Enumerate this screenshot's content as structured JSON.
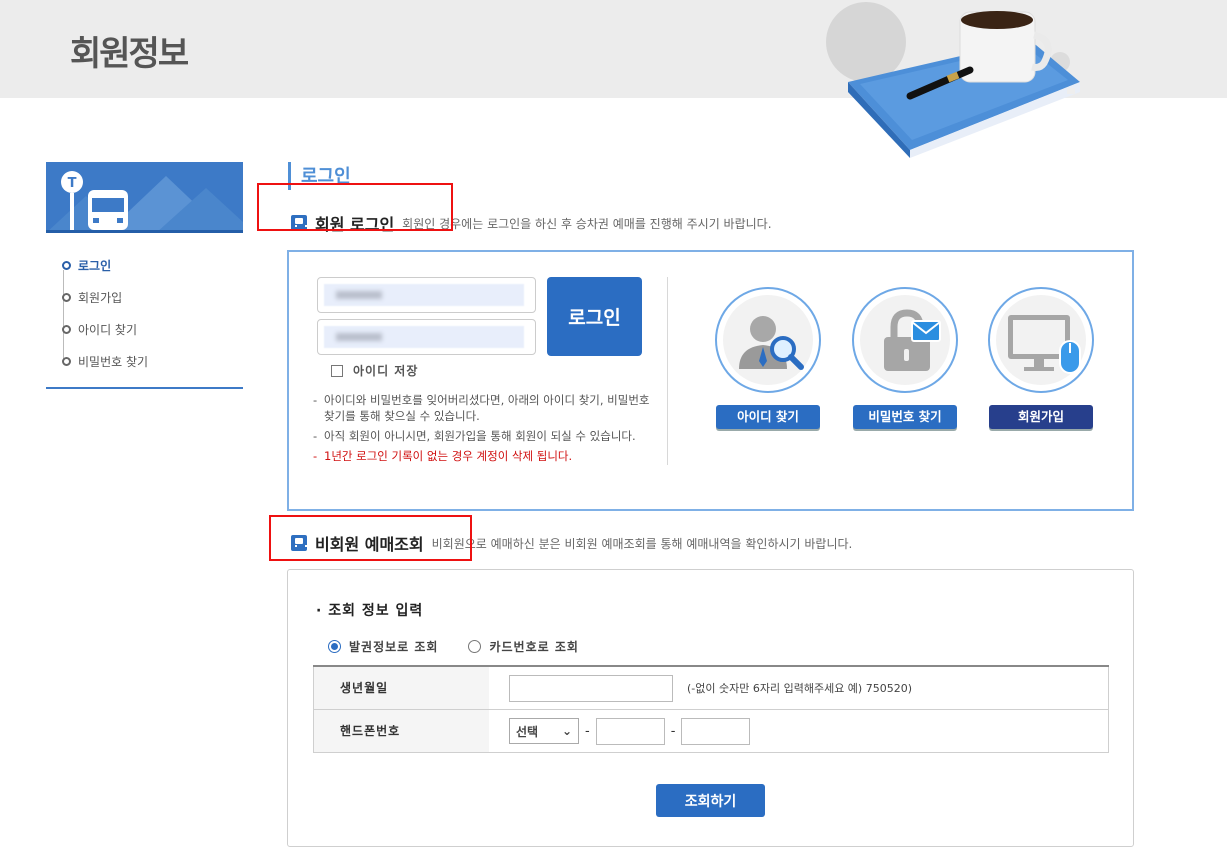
{
  "header": {
    "title": "회원정보"
  },
  "sidebar": {
    "items": [
      {
        "label": "로그인",
        "active": true
      },
      {
        "label": "회원가입",
        "active": false
      },
      {
        "label": "아이디 찾기",
        "active": false
      },
      {
        "label": "비밀번호 찾기",
        "active": false
      }
    ]
  },
  "login_section": {
    "heading": "로그인",
    "member_title": "회원 로그인",
    "member_desc": "회원인 경우에는 로그인을 하신 후 승차권 예매를 진행해 주시기 바랍니다.",
    "login_button": "로그인",
    "save_id_label": "아이디 저장",
    "notes": [
      "아이디와 비밀번호를 잊어버리셨다면, 아래의 아이디 찾기, 비밀번호 찾기를 통해 찾으실 수 있습니다.",
      "아직 회원이 아니시면, 회원가입을 통해 회원이 되실 수 있습니다.",
      "1년간 로그인 기록이 없는 경우 계정이 삭제 됩니다."
    ],
    "actions": [
      {
        "label": "아이디 찾기",
        "icon": "person-search-icon"
      },
      {
        "label": "비밀번호 찾기",
        "icon": "lock-mail-icon"
      },
      {
        "label": "회원가입",
        "icon": "monitor-mouse-icon"
      }
    ]
  },
  "nonmember_section": {
    "title": "비회원 예매조회",
    "desc": "비회원으로 예매하신 분은 비회원 예매조회를 통해 예매내역을 확인하시기 바랍니다.",
    "subheading": "· 조회 정보 입력",
    "radio_options": [
      {
        "label": "발권정보로 조회",
        "selected": true
      },
      {
        "label": "카드번호로 조회",
        "selected": false
      }
    ],
    "birth_label": "생년월일",
    "birth_hint": "(-없이 숫자만 6자리 입력해주세요 예) 750520)",
    "phone_label": "핸드폰번호",
    "phone_select": "선택",
    "phone_dash": "-",
    "query_button": "조회하기"
  },
  "colors": {
    "accent": "#2b6dc2",
    "navy": "#273f8c",
    "warning": "#d01010",
    "highlight_box": "#ee1111"
  }
}
